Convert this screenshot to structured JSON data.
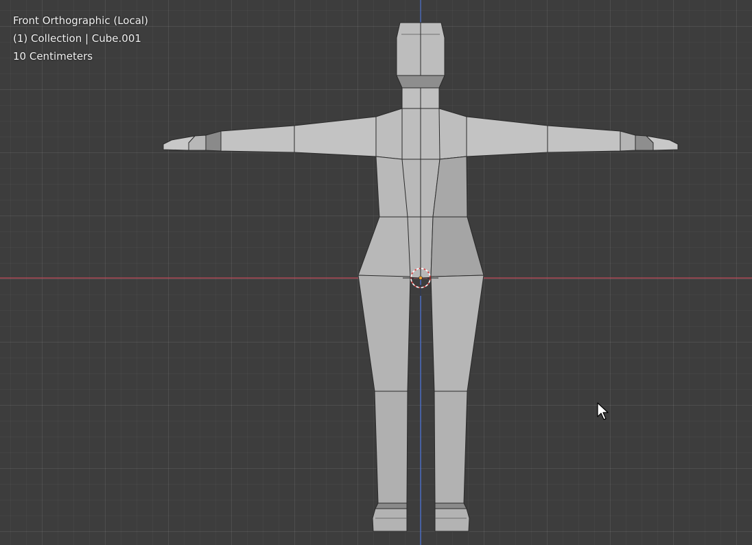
{
  "viewport": {
    "view_name": "Front Orthographic (Local)",
    "collection_info": "(1) Collection | Cube.001",
    "grid_scale": "10 Centimeters"
  },
  "colors": {
    "background": "#3d3d3d",
    "grid_line": "#4a4a4a",
    "x_axis": "#c2485a",
    "z_axis": "#4a6fcc",
    "mesh_face": "#bcbcbc",
    "mesh_face_dark": "#8c8c8c",
    "mesh_edge": "#2a2a2a",
    "cursor_red": "#d94040"
  },
  "icons": {
    "origin": "object-origin-icon",
    "cursor3d": "3d-cursor-icon",
    "pointer": "mouse-pointer-icon"
  }
}
